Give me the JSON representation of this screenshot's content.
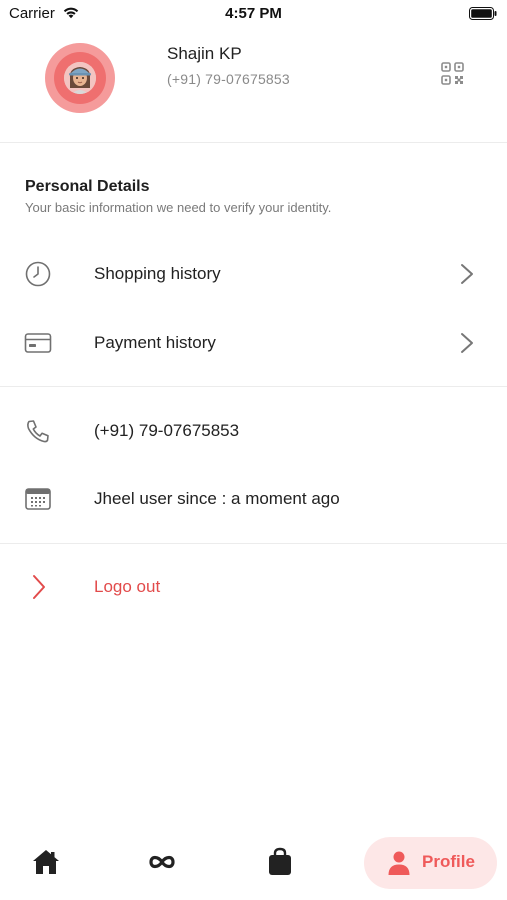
{
  "status_bar": {
    "carrier": "Carrier",
    "time": "4:57 PM"
  },
  "profile": {
    "name": "Shajin KP",
    "phone": "(+91)  79-07675853"
  },
  "personal_details": {
    "title": "Personal Details",
    "subtitle": "Your basic information we need to verify your identity."
  },
  "rows": {
    "shopping_history": "Shopping history",
    "payment_history": "Payment history",
    "phone": "(+91)  79-07675853",
    "member_since": "Jheel user since : a moment ago",
    "logout": "Logo out"
  },
  "bottom_nav": {
    "profile_label": "Profile",
    "active_tab": "profile"
  },
  "colors": {
    "accent": "#ef5a5a",
    "accent_bg": "#fde7e7",
    "logout": "#e24b4b"
  },
  "icons": {
    "home": "home-icon",
    "explore": "infinity-icon",
    "bag": "shopping-bag-icon",
    "profile": "person-icon",
    "qr": "qr-code-icon"
  }
}
